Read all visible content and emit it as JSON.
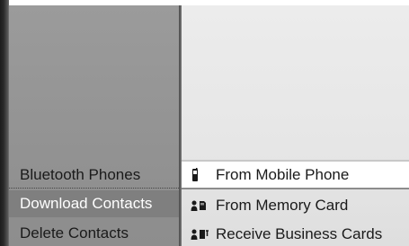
{
  "main_menu": {
    "items": [
      {
        "label": "Bluetooth Phones",
        "state": "normal"
      },
      {
        "label": "Download Contacts",
        "state": "selected"
      },
      {
        "label": "Delete Contacts",
        "state": "normal"
      }
    ]
  },
  "submenu": {
    "items": [
      {
        "label": "From Mobile Phone",
        "icon": "mobile-phone-icon",
        "state": "highlighted"
      },
      {
        "label": "From Memory Card",
        "icon": "memory-card-icon",
        "state": "normal"
      },
      {
        "label": "Receive Business Cards",
        "icon": "business-card-bt-icon",
        "state": "normal"
      }
    ]
  },
  "colors": {
    "main_panel": "#939393",
    "selected_item": "#7f7f7f",
    "submenu_panel": "#e6e6e6",
    "highlight": "#ffffff",
    "text": "#1a1a1a"
  }
}
